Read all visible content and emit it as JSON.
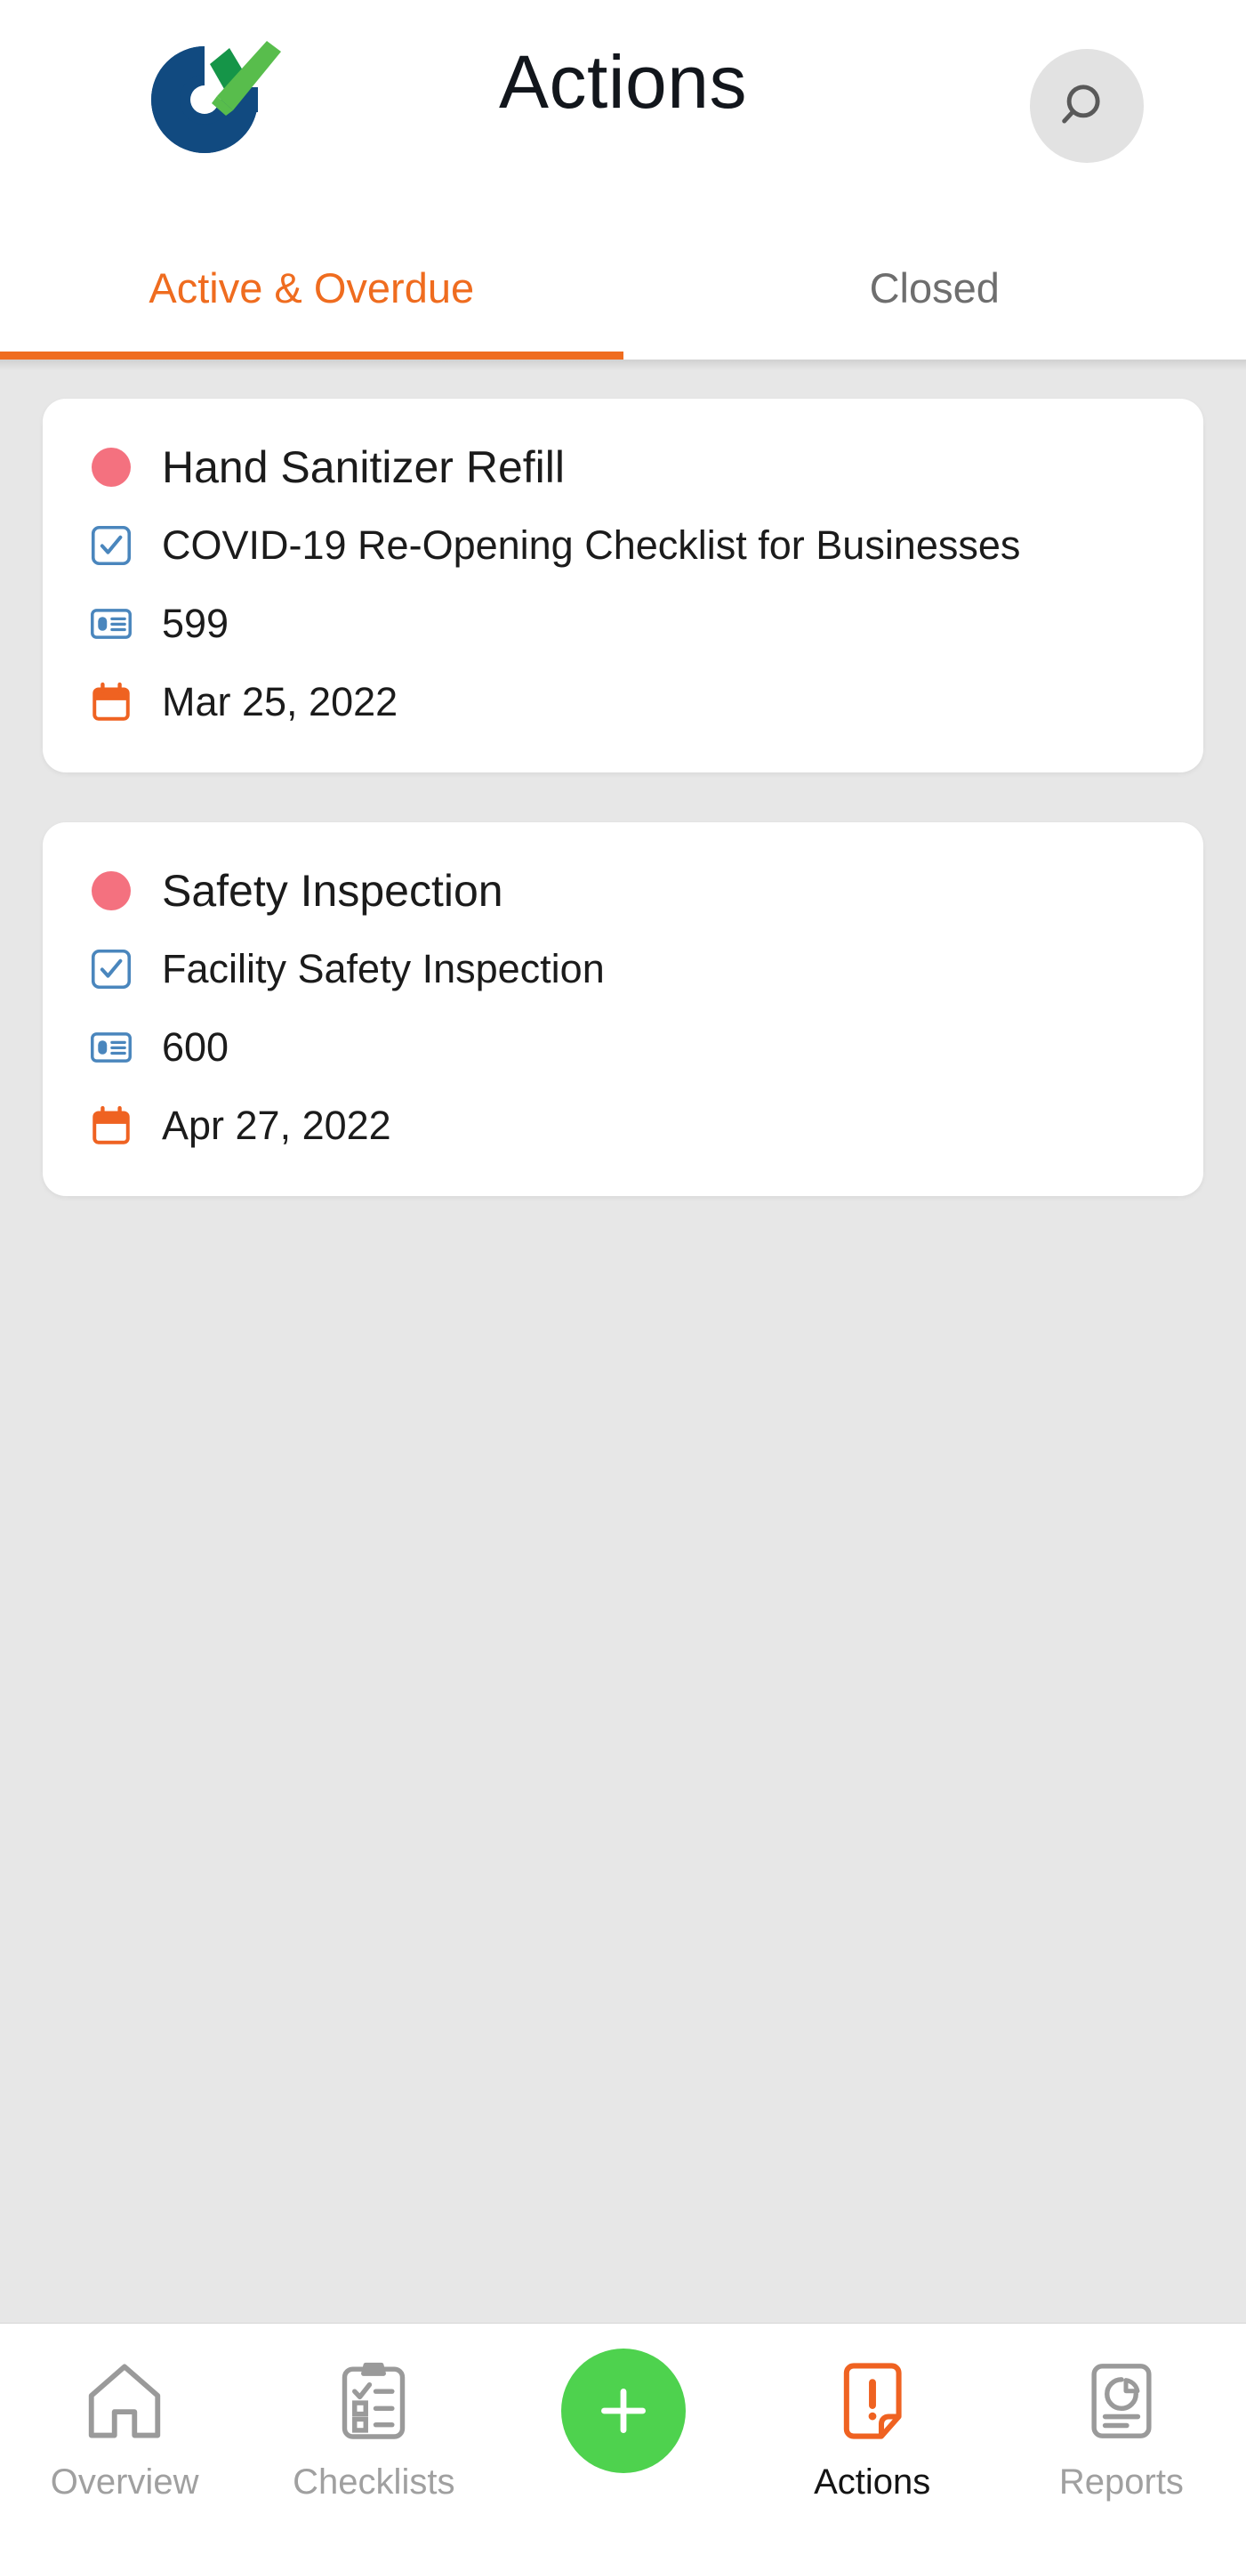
{
  "header": {
    "title": "Actions",
    "logo_name": "logo-checkmark-c",
    "logo_colors": {
      "blue": "#114a80",
      "green_light": "#58bd4c",
      "green_dark": "#159548"
    },
    "search_icon": "search-icon"
  },
  "tabs": [
    {
      "label": "Active & Overdue",
      "active": true
    },
    {
      "label": "Closed",
      "active": false
    }
  ],
  "theme": {
    "accent_orange": "#ef6c1f",
    "status_red": "#f4717f",
    "icon_blue": "#4a86bd",
    "fab_green": "#4ed24e",
    "page_bg": "#e7e7e7",
    "card_bg": "#ffffff",
    "inactive_gray": "#a0a0a0"
  },
  "cards": [
    {
      "status_icon": "status-dot-red",
      "title": "Hand Sanitizer Refill",
      "checklist_icon": "checkbox-checked-icon",
      "checklist": "COVID-19 Re-Opening Checklist for Businesses",
      "id_icon": "id-card-icon",
      "id": "599",
      "date_icon": "calendar-icon",
      "date": "Mar 25, 2022"
    },
    {
      "status_icon": "status-dot-red",
      "title": "Safety Inspection",
      "checklist_icon": "checkbox-checked-icon",
      "checklist": "Facility Safety Inspection",
      "id_icon": "id-card-icon",
      "id": "600",
      "date_icon": "calendar-icon",
      "date": "Apr 27, 2022"
    }
  ],
  "bottom_nav": [
    {
      "label": "Overview",
      "icon": "home-icon",
      "active": false
    },
    {
      "label": "Checklists",
      "icon": "clipboard-check-icon",
      "active": false
    },
    {
      "label": "",
      "icon": "plus-icon",
      "active": false
    },
    {
      "label": "Actions",
      "icon": "document-alert-icon",
      "active": true
    },
    {
      "label": "Reports",
      "icon": "report-piechart-icon",
      "active": false
    }
  ]
}
